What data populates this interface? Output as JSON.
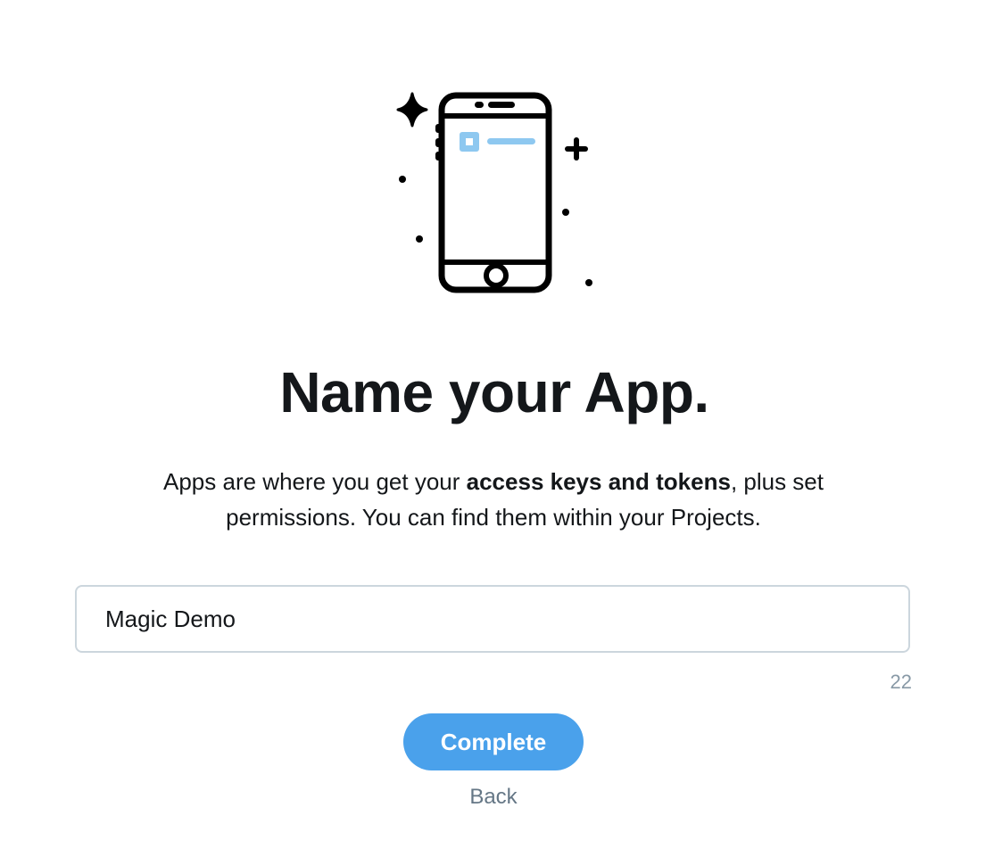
{
  "illustration": {
    "icon": "smartphone-with-sparkles-icon",
    "accent_color": "#8ec8f0"
  },
  "heading": {
    "title": "Name your App."
  },
  "description": {
    "part1": "Apps are where you get your ",
    "bold": "access keys and tokens",
    "part2": ", plus set permissions. You can find them within your Projects."
  },
  "app_name_input": {
    "value": "Magic Demo",
    "remaining_chars": "22"
  },
  "actions": {
    "complete_label": "Complete",
    "back_label": "Back",
    "primary_color": "#4aa1eb"
  }
}
